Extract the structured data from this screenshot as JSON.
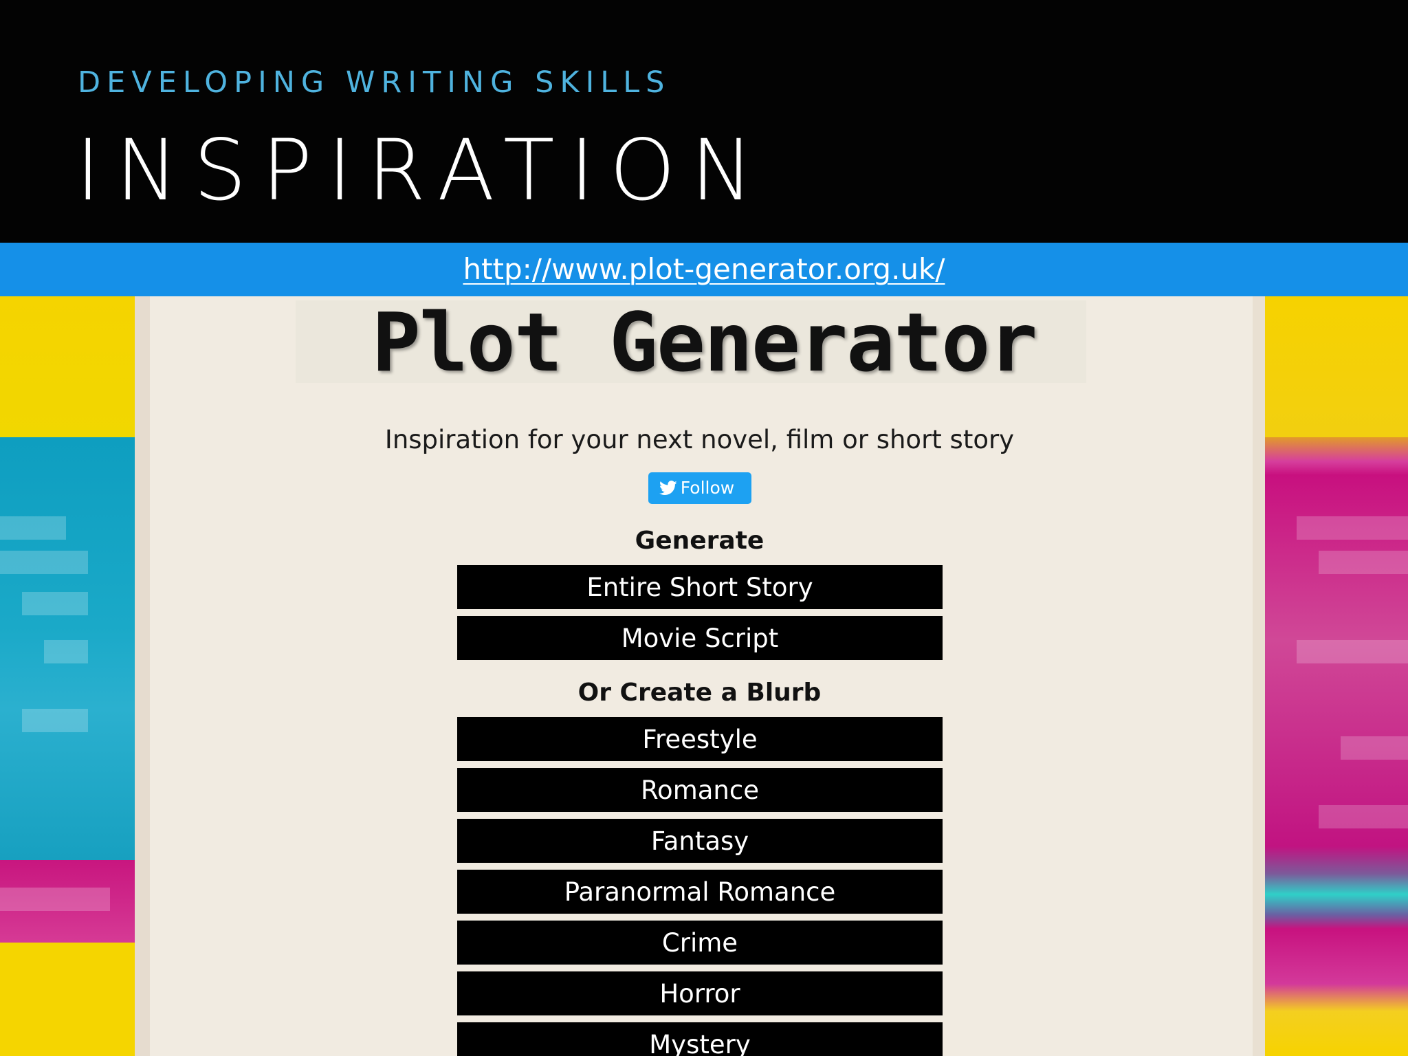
{
  "slide": {
    "subtitle": "DEVELOPING WRITING SKILLS",
    "title": "INSPIRATION",
    "url": "http://www.plot-generator.org.uk/"
  },
  "site": {
    "logo": "Plot Generator",
    "tagline": "Inspiration for your next novel, film or short story",
    "follow_label": "Follow",
    "generate_heading": "Generate",
    "generate_buttons": [
      "Entire Short Story",
      "Movie Script"
    ],
    "blurb_heading": "Or Create a Blurb",
    "blurb_buttons": [
      "Freestyle",
      "Romance",
      "Fantasy",
      "Paranormal Romance",
      "Crime",
      "Horror",
      "Mystery"
    ]
  },
  "colors": {
    "subtitle": "#4fb3df",
    "url_bar": "#1590e8",
    "follow_button": "#1da1f2",
    "page_background": "#f1ebe1"
  },
  "icons": {
    "follow": "twitter-bird-icon"
  }
}
